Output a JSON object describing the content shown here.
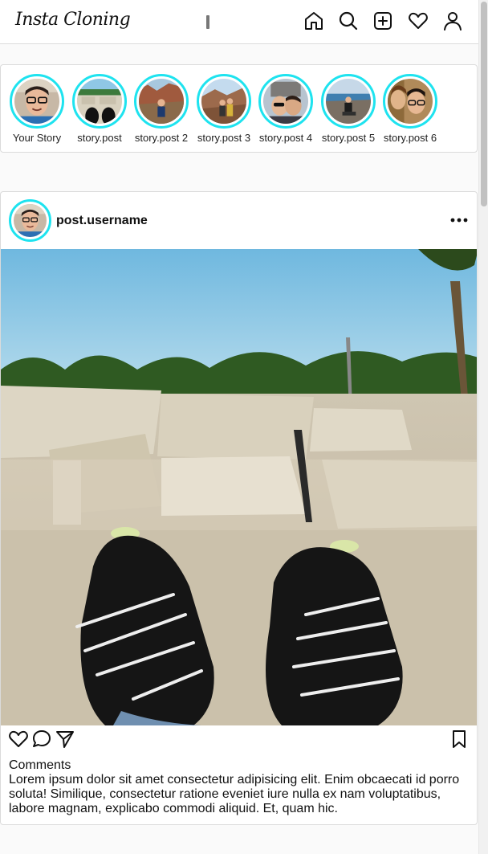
{
  "header": {
    "logo": "Insta Cloning",
    "nav": [
      "home-icon",
      "search-icon",
      "add-post-icon",
      "heart-icon",
      "profile-icon"
    ]
  },
  "stories": [
    {
      "label": "Your Story"
    },
    {
      "label": "story.post"
    },
    {
      "label": "story.post 2"
    },
    {
      "label": "story.post 3"
    },
    {
      "label": "story.post 4"
    },
    {
      "label": "story.post 5"
    },
    {
      "label": "story.post 6"
    }
  ],
  "post": {
    "username": "post.username",
    "comments_title": "Comments",
    "comments_text": "Lorem ipsum dolor sit amet consectetur adipisicing elit. Enim obcaecati id porro soluta! Similique, consectetur ratione eveniet iure nulla ex nam voluptatibus, labore magnam, explicabo commodi aliquid. Et, quam hic."
  },
  "colors": {
    "story_ring": "#1ee3ef",
    "border": "#dbdbdb"
  }
}
